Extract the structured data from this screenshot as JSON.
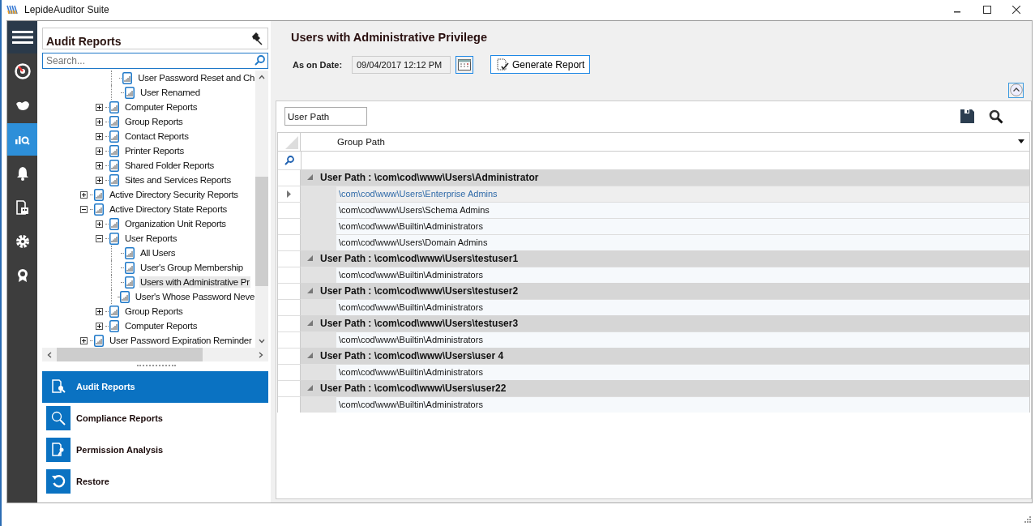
{
  "window": {
    "title": "LepideAuditor Suite"
  },
  "rail": [
    {
      "kind": "dashboard",
      "selected": false
    },
    {
      "kind": "hand",
      "selected": false
    },
    {
      "kind": "reports",
      "selected": true
    },
    {
      "kind": "alerts",
      "selected": false
    },
    {
      "kind": "server",
      "selected": false
    },
    {
      "kind": "settings",
      "selected": false
    },
    {
      "kind": "license",
      "selected": false
    }
  ],
  "left_panel": {
    "title": "Audit Reports",
    "search": {
      "placeholder": "Search..."
    },
    "tree": {
      "children": [
        {
          "children": [
            {
              "children": [
                {
                  "label": "User Password Reset and Ch",
                  "selected": false
                },
                {
                  "label": "User Renamed",
                  "selected": false
                }
              ]
            },
            {
              "label": "Computer Reports",
              "expanded": false,
              "selected": false
            },
            {
              "label": "Group Reports",
              "expanded": false,
              "selected": false
            },
            {
              "label": "Contact Reports",
              "expanded": false,
              "selected": false
            },
            {
              "label": "Printer Reports",
              "expanded": false,
              "selected": false
            },
            {
              "label": "Shared Folder Reports",
              "expanded": false,
              "selected": false
            },
            {
              "label": "Sites and Services Reports",
              "expanded": false,
              "selected": false
            }
          ]
        },
        {
          "label": "Active Directory Security Reports",
          "expanded": false,
          "selected": false
        },
        {
          "label": "Active Directory State Reports",
          "expanded": true,
          "selected": false,
          "children": [
            {
              "label": "Organization Unit Reports",
              "expanded": false,
              "selected": false
            },
            {
              "label": "User Reports",
              "expanded": true,
              "selected": false,
              "children": [
                {
                  "label": "All Users",
                  "selected": false
                },
                {
                  "label": "User's Group Membership",
                  "selected": false
                },
                {
                  "label": "Users with Administrative Pr",
                  "selected": true
                },
                {
                  "label": "User's Whose Password Neve",
                  "selected": false
                }
              ]
            },
            {
              "label": "Group Reports",
              "expanded": false,
              "selected": false
            },
            {
              "label": "Computer Reports",
              "expanded": false,
              "selected": false
            }
          ]
        },
        {
          "label": "User Password Expiration Reminder",
          "expanded": false,
          "selected": false
        }
      ]
    },
    "nav": [
      {
        "kind": "audit",
        "label": "Audit Reports",
        "selected": true
      },
      {
        "kind": "compliance",
        "label": "Compliance Reports",
        "selected": false
      },
      {
        "kind": "permission",
        "label": "Permission Analysis",
        "selected": false
      },
      {
        "kind": "restore",
        "label": "Restore",
        "selected": false
      }
    ]
  },
  "report": {
    "title": "Users with Administrative Privilege",
    "date_label": "As on Date:",
    "date_value": "09/04/2017 12:12 PM",
    "generate_button": "Generate Report",
    "group_by_chip": "User Path",
    "column": "Group Path",
    "groups": [
      {
        "label": "User Path : \\com\\cod\\www\\Users\\Administrator",
        "expanded": true,
        "rows": [
          {
            "text": "\\com\\cod\\www\\Users\\Enterprise Admins",
            "selected": true
          },
          {
            "text": "\\com\\cod\\www\\Users\\Schema Admins",
            "selected": false
          },
          {
            "text": "\\com\\cod\\www\\Builtin\\Administrators",
            "selected": false
          },
          {
            "text": "\\com\\cod\\www\\Users\\Domain Admins",
            "selected": false
          }
        ]
      },
      {
        "label": "User Path : \\com\\cod\\www\\Users\\testuser1",
        "expanded": true,
        "rows": [
          {
            "text": "\\com\\cod\\www\\Builtin\\Administrators",
            "selected": false
          }
        ]
      },
      {
        "label": "User Path : \\com\\cod\\www\\Users\\testuser2",
        "expanded": true,
        "rows": [
          {
            "text": "\\com\\cod\\www\\Builtin\\Administrators",
            "selected": false
          }
        ]
      },
      {
        "label": "User Path : \\com\\cod\\www\\Users\\testuser3",
        "expanded": true,
        "rows": [
          {
            "text": "\\com\\cod\\www\\Builtin\\Administrators",
            "selected": false
          }
        ]
      },
      {
        "label": "User Path : \\com\\cod\\www\\Users\\user 4",
        "expanded": true,
        "rows": [
          {
            "text": "\\com\\cod\\www\\Builtin\\Administrators",
            "selected": false
          }
        ]
      },
      {
        "label": "User Path : \\com\\cod\\www\\Users\\user22",
        "expanded": true,
        "rows": [
          {
            "text": "\\com\\cod\\www\\Builtin\\Administrators",
            "selected": false
          }
        ]
      }
    ]
  }
}
